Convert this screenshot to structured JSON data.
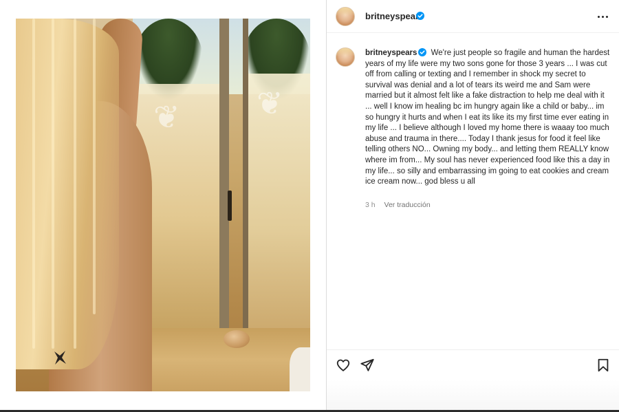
{
  "post": {
    "username": "britneyspears",
    "verified": true,
    "caption": "We're just people so fragile and human the hardest years of my life were my two sons gone for those 3 years ... I was cut off from calling or texting and I remember in shock my secret to survival was denial and a lot of tears its weird me and Sam were married but it almost felt like a fake distraction to help me deal with it ... well I know im healing bc im hungry again like a child or baby... im so hungry it hurts and when I eat its like its my first time ever eating in my life ... I believe although I loved my home there is waaay too much abuse and trauma in there.... Today I thank jesus for food it feel like telling others NO... Owning my body... and letting them REALLY know where im from... My soul has never experienced food like this a day in my life... so silly and embarrassing im going to eat cookies and cream ice cream now... god bless u all",
    "time_ago": "3 h",
    "translate_label": "Ver traducción"
  },
  "icons": {
    "more": "more-options-icon",
    "like": "heart-icon",
    "share": "paper-plane-icon",
    "save": "bookmark-icon",
    "verified": "verified-badge-icon"
  },
  "colors": {
    "verified_blue": "#0095f6",
    "text": "#262626",
    "muted": "#8e8e8e"
  }
}
